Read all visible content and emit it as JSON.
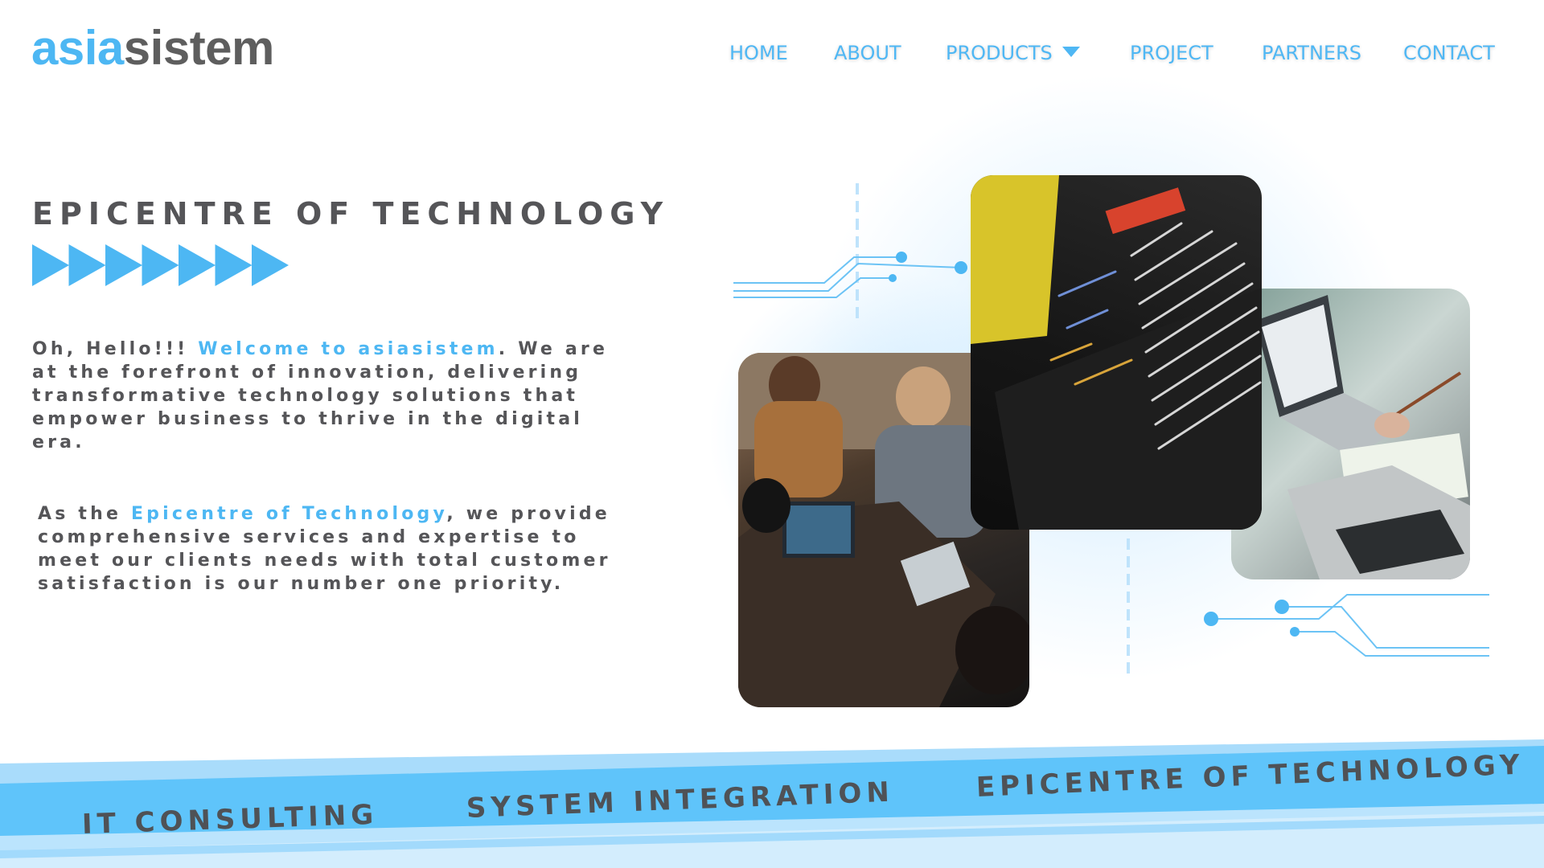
{
  "header": {
    "logo": {
      "part_a": "asia",
      "part_b": "sistem"
    },
    "nav": [
      {
        "label": "HOME"
      },
      {
        "label": "ABOUT"
      },
      {
        "label": "PRODUCTS",
        "has_dropdown": true
      },
      {
        "label": "PROJECT"
      },
      {
        "label": "PARTNERS"
      },
      {
        "label": "CONTACT"
      }
    ]
  },
  "hero": {
    "headline": "EPICENTRE OF TECHNOLOGY",
    "arrow_icon": "play-arrow-icon",
    "arrow_count": 7,
    "intro": {
      "lead": "Oh, Hello!!! ",
      "highlight": "Welcome to asiasistem",
      "rest": ". We are at the forefront of innovation, delivering transformative technology solutions that empower business to thrive in the digital era."
    },
    "about": {
      "lead": "As the ",
      "highlight": "Epicentre of Technology",
      "rest": ", we provide comprehensive services and expertise to meet our clients needs with total customer satisfaction is our number one priority."
    }
  },
  "gallery": [
    {
      "name": "team-working-photo"
    },
    {
      "name": "code-screen-photo"
    },
    {
      "name": "laptop-notes-photo"
    }
  ],
  "ribbon": {
    "items": [
      "IT CONSULTING",
      "SYSTEM INTEGRATION",
      "EPICENTRE OF TECHNOLOGY"
    ]
  },
  "colors": {
    "accent": "#4db7f3",
    "text": "#555558",
    "ribbon_main": "#5fc4fa",
    "ribbon_light": "#a9dcfb"
  }
}
